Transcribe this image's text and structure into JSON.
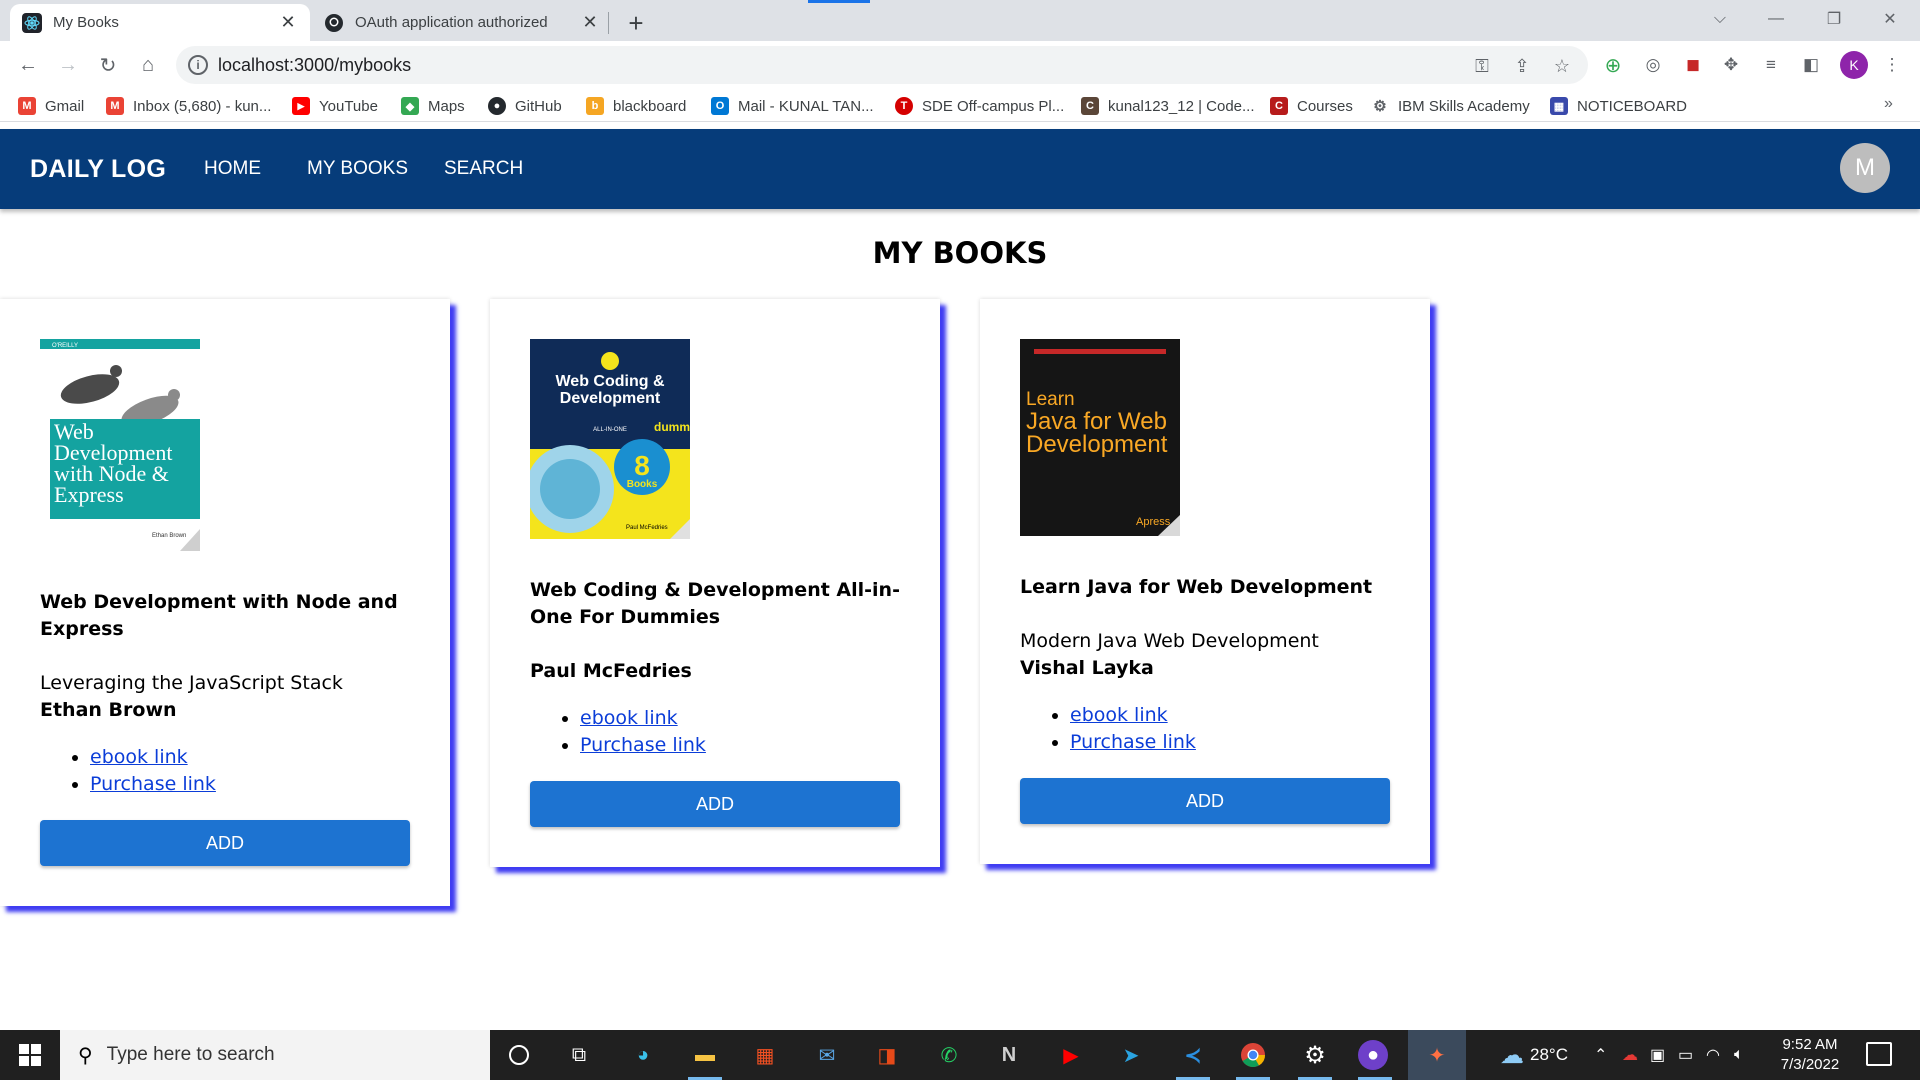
{
  "browser": {
    "tabs": [
      {
        "title": "My Books",
        "active": true
      },
      {
        "title": "OAuth application authorized",
        "active": false
      }
    ],
    "url": "localhost:3000/mybooks",
    "profile_initial": "K",
    "bookmarks": [
      {
        "label": "Gmail",
        "icon": "gmail-icon",
        "color": "#ea4335",
        "glyph": "M"
      },
      {
        "label": "Inbox (5,680) - kun...",
        "icon": "gmail-icon",
        "color": "#ea4335",
        "glyph": "M"
      },
      {
        "label": "YouTube",
        "icon": "youtube-icon",
        "color": "#ff0000",
        "glyph": "▶"
      },
      {
        "label": "Maps",
        "icon": "maps-icon",
        "color": "#34a853",
        "glyph": "◆"
      },
      {
        "label": "GitHub",
        "icon": "github-icon",
        "color": "#24292e",
        "glyph": "●"
      },
      {
        "label": "blackboard",
        "icon": "blackboard-icon",
        "color": "#f5a623",
        "glyph": "b"
      },
      {
        "label": "Mail - KUNAL TAN...",
        "icon": "outlook-icon",
        "color": "#0078d4",
        "glyph": "O"
      },
      {
        "label": "SDE Off-campus Pl...",
        "icon": "tuf-icon",
        "color": "#d50000",
        "glyph": "T"
      },
      {
        "label": "kunal123_12 | Code...",
        "icon": "codechef-icon",
        "color": "#5b4638",
        "glyph": "C"
      },
      {
        "label": "Courses",
        "icon": "courses-icon",
        "color": "#b71c1c",
        "glyph": "C"
      },
      {
        "label": "IBM Skills Academy",
        "icon": "ibm-icon",
        "color": "#5f6368",
        "glyph": "⚙"
      },
      {
        "label": "NOTICEBOARD",
        "icon": "noticeboard-icon",
        "color": "#3949ab",
        "glyph": "▦"
      }
    ]
  },
  "app": {
    "brand": "DAILY LOG",
    "nav": [
      "HOME",
      "MY BOOKS",
      "SEARCH"
    ],
    "avatar_initial": "M",
    "page_title": "MY BOOKS"
  },
  "books": [
    {
      "title": "Web Development with Node and Express",
      "subtitle": "Leveraging the JavaScript Stack",
      "author": "Ethan Brown",
      "ebook_label": "ebook link",
      "purchase_label": "Purchase link",
      "add_label": "ADD",
      "cover": {
        "publisher_mark": "O'REILLY",
        "title": "Web Development with Node & Express",
        "author": "Ethan Brown"
      }
    },
    {
      "title": "Web Coding & Development All-in-One For Dummies",
      "subtitle": "",
      "author": "Paul McFedries",
      "ebook_label": "ebook link",
      "purchase_label": "Purchase link",
      "add_label": "ADD",
      "cover": {
        "title": "Web Coding & Development",
        "tag": "ALL-IN-ONE",
        "brand": "dummies",
        "count": "8",
        "count_label": "Books",
        "author": "Paul McFedries"
      }
    },
    {
      "title": "Learn Java for Web Development",
      "subtitle": "Modern Java Web Development",
      "author": "Vishal Layka",
      "ebook_label": "ebook link",
      "purchase_label": "Purchase link",
      "add_label": "ADD",
      "cover": {
        "line1": "Learn",
        "line2": "Java for Web",
        "line3": "Development",
        "publisher": "Apress"
      }
    }
  ],
  "taskbar": {
    "search_placeholder": "Type here to search",
    "temperature": "28°C",
    "time": "9:52 AM",
    "date": "7/3/2022"
  }
}
